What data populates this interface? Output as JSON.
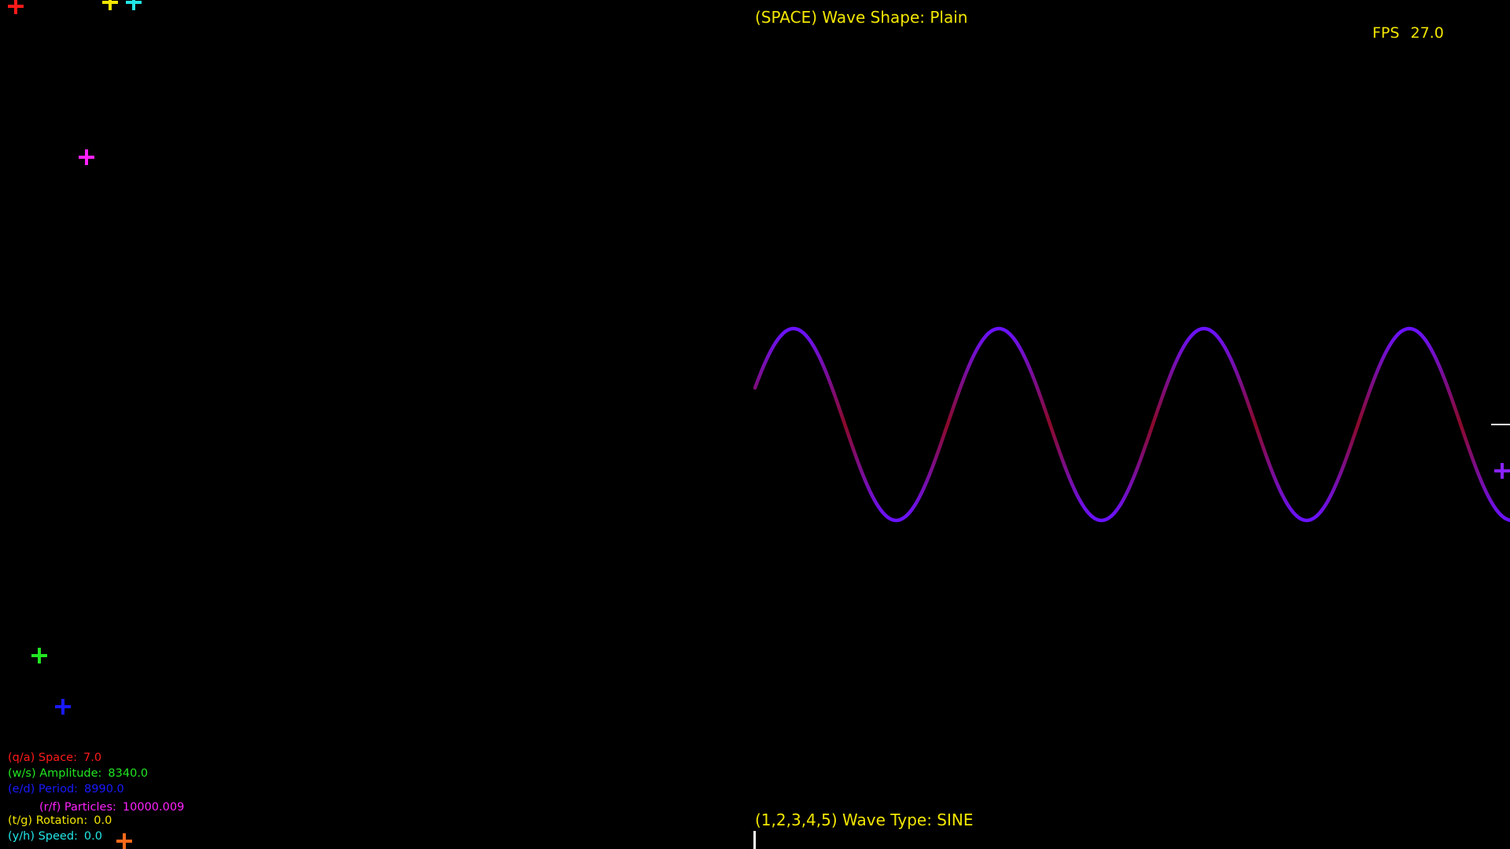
{
  "hud": {
    "wave_shape": "(SPACE) Wave Shape: Plain",
    "wave_type": "(1,2,3,4,5) Wave Type: SINE",
    "fps_label": "FPS",
    "fps_value": "27.0"
  },
  "controls": {
    "space": {
      "label": "(q/a) Space:",
      "value": "7.0",
      "color": "#ff1a1a"
    },
    "amplitude": {
      "label": "(w/s) Amplitude:",
      "value": "8340.0",
      "color": "#22e622"
    },
    "period": {
      "label": "(e/d) Period:",
      "value": "8990.0",
      "color": "#1a1aff"
    },
    "particles": {
      "label": "(r/f) Particles:",
      "value": "10000.009",
      "color": "#ff22ff"
    },
    "rotation": {
      "label": "(t/g) Rotation:",
      "value": "0.0",
      "color": "#f2e600"
    },
    "speed": {
      "label": "(y/h) Speed:",
      "value": "0.0",
      "color": "#22e6e6"
    }
  },
  "markers": {
    "red": "#ff1a1a",
    "yellow": "#f2e600",
    "cyan": "#22e6e6",
    "magenta": "#ff22ff",
    "green": "#22e622",
    "blue": "#1a1aff",
    "orange": "#ff6a1a",
    "violet": "#8a22ff",
    "white": "#ffffff"
  },
  "wave": {
    "type": "sine",
    "crest_color": "#6a12ff",
    "trough_color": "#8a0a2a"
  }
}
